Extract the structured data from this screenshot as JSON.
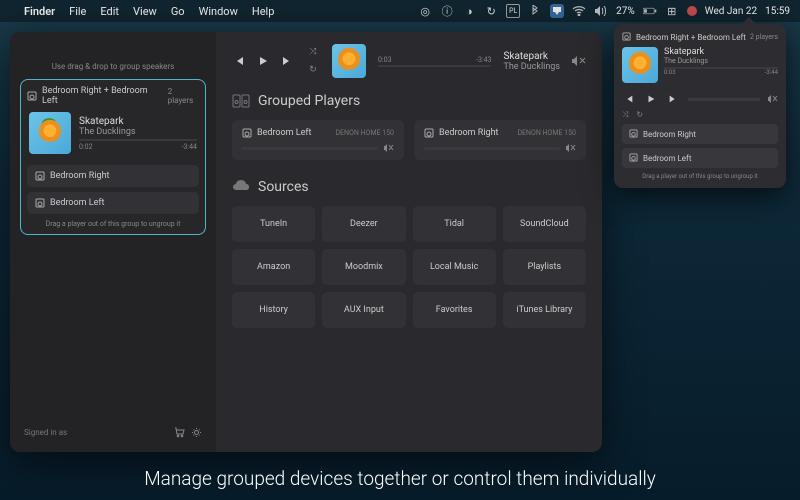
{
  "menubar": {
    "app": "Finder",
    "menus": [
      "File",
      "Edit",
      "View",
      "Go",
      "Window",
      "Help"
    ],
    "battery": "27%",
    "date": "Wed Jan 22",
    "time": "15:59",
    "input": "PL"
  },
  "sidebar": {
    "drag_hint": "Use drag & drop to group speakers",
    "group": {
      "name": "Bedroom Right + Bedroom Left",
      "player_count": "2 players",
      "track": "Skatepark",
      "artist": "The Ducklings",
      "elapsed": "0:02",
      "remaining": "-3:44",
      "speakers": [
        "Bedroom Right",
        "Bedroom Left"
      ],
      "foot": "Drag a player out of this group to ungroup it"
    },
    "signed_in": "Signed in as"
  },
  "main": {
    "track": "Skatepark",
    "artist": "The Ducklings",
    "elapsed": "0:03",
    "remaining": "-3:43",
    "grouped_h": "Grouped Players",
    "players": [
      {
        "name": "Bedroom Left",
        "model": "DENON HOME 150"
      },
      {
        "name": "Bedroom Right",
        "model": "DENON HOME 150"
      }
    ],
    "sources_h": "Sources",
    "sources": [
      "TuneIn",
      "Deezer",
      "Tidal",
      "SoundCloud",
      "Amazon",
      "Moodmix",
      "Local Music",
      "Playlists",
      "History",
      "AUX Input",
      "Favorites",
      "iTunes Library"
    ]
  },
  "popover": {
    "name": "Bedroom Right + Bedroom Left",
    "count": "2 players",
    "track": "Skatepark",
    "artist": "The Ducklings",
    "elapsed": "0:03",
    "remaining": "-3:44",
    "speakers": [
      "Bedroom Right",
      "Bedroom Left"
    ],
    "foot": "Drag a player out of this group to ungroup it"
  },
  "caption": "Manage grouped devices together or control them individually"
}
